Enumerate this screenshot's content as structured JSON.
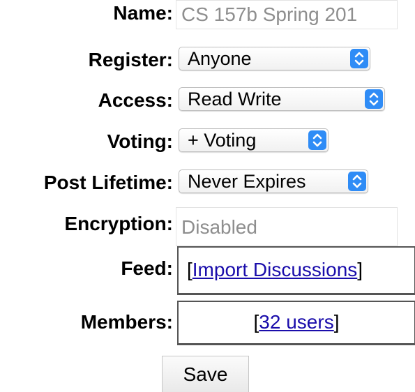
{
  "form": {
    "name": {
      "label": "Name:",
      "value": "CS 157b Spring 201"
    },
    "register": {
      "label": "Register:",
      "selected": "Anyone"
    },
    "access": {
      "label": "Access:",
      "selected": "Read Write"
    },
    "voting": {
      "label": "Voting:",
      "selected": "+ Voting"
    },
    "post_lifetime": {
      "label": "Post Lifetime:",
      "selected": "Never Expires"
    },
    "encryption": {
      "label": "Encryption:",
      "value": "Disabled"
    },
    "feed": {
      "label": "Feed:",
      "open_bracket": "[",
      "link_text": "Import Discussions",
      "close_bracket": "]"
    },
    "members": {
      "label": "Members:",
      "open_bracket": "[",
      "link_text": "32 users",
      "close_bracket": "]"
    },
    "save_label": "Save"
  },
  "colors": {
    "select_arrow_bg": "#2f8cf6",
    "link": "#1a0dab",
    "disabled_text": "#8e8e8e"
  },
  "icons": {
    "select_arrow": "updown-chevron-icon"
  }
}
